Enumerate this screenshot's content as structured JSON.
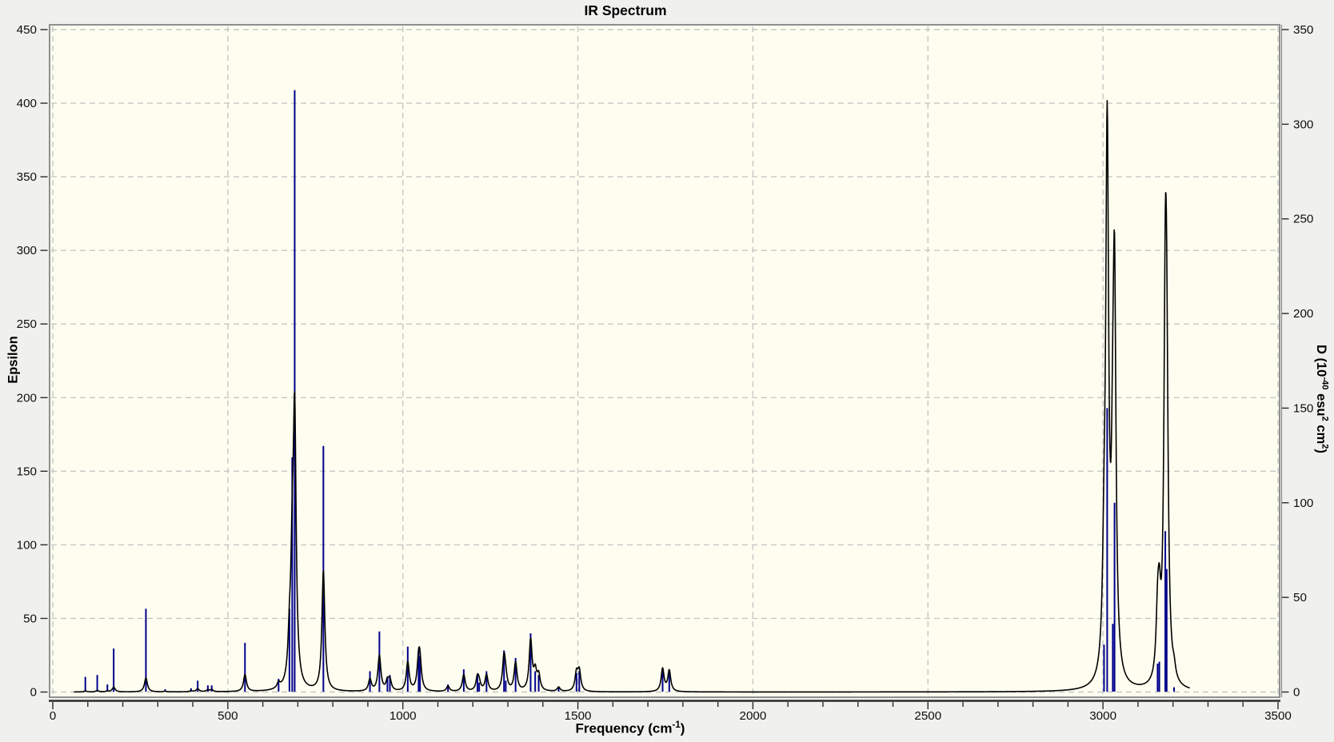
{
  "window": {
    "title": "IR Spectrum"
  },
  "chart_data": {
    "type": "line",
    "subtype": "ir_spectrum_sticks_plus_broadened_curve",
    "title": "IR Spectrum",
    "x_axis": {
      "label": "Frequency (cm^-1^)",
      "min": 0,
      "max": 3500,
      "major_tick": 500,
      "minor_tick": 100,
      "major_tick_labels": [
        "0",
        "500",
        "1000",
        "1500",
        "2000",
        "2500",
        "3000",
        "3500"
      ]
    },
    "y_axis_left": {
      "label": "Epsilon",
      "min": 0,
      "max": 450,
      "tick": 50,
      "tick_labels": [
        "0",
        "50",
        "100",
        "150",
        "200",
        "250",
        "300",
        "350",
        "400",
        "450"
      ],
      "series": "broadened-curve"
    },
    "y_axis_right": {
      "label": "D (10^-40^ esu^2^ cm^2^)",
      "min": 0,
      "max": 350,
      "tick": 50,
      "tick_labels": [
        "0",
        "50",
        "100",
        "150",
        "200",
        "250",
        "300",
        "350"
      ],
      "series": "stick-spectrum"
    },
    "sticks": {
      "columns": [
        "frequency_cm-1",
        "D_10^-40_esu2_cm2"
      ],
      "points": [
        [
          93,
          8
        ],
        [
          127,
          9
        ],
        [
          156,
          4
        ],
        [
          174,
          23
        ],
        [
          266,
          44
        ],
        [
          321,
          1.5
        ],
        [
          395,
          2
        ],
        [
          414,
          6
        ],
        [
          443,
          3.5
        ],
        [
          454,
          3.5
        ],
        [
          549,
          26
        ],
        [
          645,
          7
        ],
        [
          676,
          44
        ],
        [
          684,
          124
        ],
        [
          691,
          318
        ],
        [
          773,
          130
        ],
        [
          906,
          11
        ],
        [
          933,
          32
        ],
        [
          956,
          8
        ],
        [
          963,
          9
        ],
        [
          1014,
          24
        ],
        [
          1045,
          22
        ],
        [
          1049,
          19
        ],
        [
          1129,
          4
        ],
        [
          1174,
          12
        ],
        [
          1213,
          9
        ],
        [
          1218,
          5
        ],
        [
          1239,
          11
        ],
        [
          1289,
          22
        ],
        [
          1294,
          6
        ],
        [
          1322,
          18
        ],
        [
          1365,
          31
        ],
        [
          1378,
          11
        ],
        [
          1388,
          9
        ],
        [
          1445,
          2.5
        ],
        [
          1496,
          10
        ],
        [
          1504,
          11
        ],
        [
          1742,
          11
        ],
        [
          1761,
          10
        ],
        [
          3003,
          25
        ],
        [
          3012,
          150
        ],
        [
          3028,
          36
        ],
        [
          3033,
          100
        ],
        [
          3156,
          15
        ],
        [
          3161,
          16
        ],
        [
          3178,
          85
        ],
        [
          3182,
          65
        ],
        [
          3203,
          2.5
        ]
      ]
    },
    "curve": {
      "model": "lorentzian_sum",
      "formula": "epsilon(v) = sum C * v0 * D * g^2 / (g^2 + (v - v0)^2)",
      "gamma_hwhm_cm1": 5,
      "scale_C": 0.00081,
      "range_cm1": [
        60,
        3248
      ],
      "observed_peak_epsilons": {
        "691": 175,
        "773": 81,
        "933": 26,
        "1365": 36,
        "3012": 395,
        "3035": 288,
        "3180": 300
      }
    },
    "grid": {
      "show": true,
      "style": "dashed",
      "color": "#c6c6c6"
    },
    "legend": {
      "show": false
    },
    "colors": {
      "page_background": "#f0f0ee",
      "plot_background": "#fefef0",
      "stick": "#00008c",
      "curve": "#000000",
      "axis_line": "#2b2b2b",
      "plot_border": "#8f8f8f",
      "text": "#000000"
    }
  }
}
